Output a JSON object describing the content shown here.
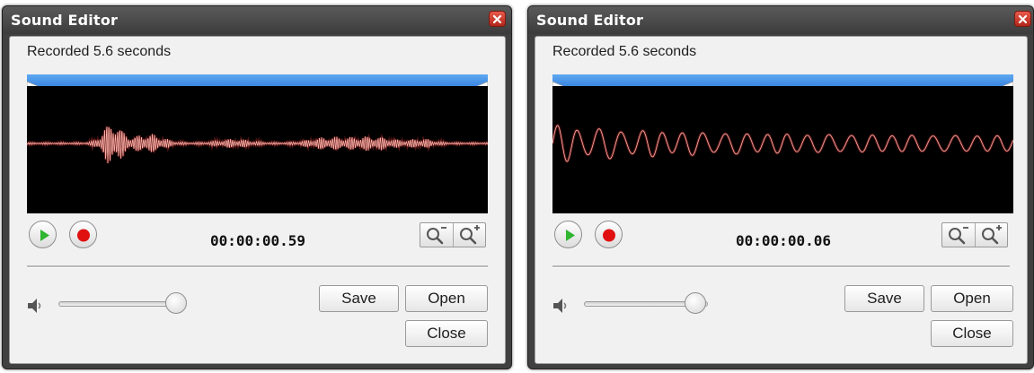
{
  "windows": [
    {
      "title": "Sound Editor",
      "status_text": "Recorded 5.6 seconds",
      "timecode": "00:00:00.59",
      "volume_level": 0.95,
      "buttons": {
        "save": "Save",
        "open": "Open",
        "close": "Close"
      }
    },
    {
      "title": "Sound Editor",
      "status_text": "Recorded 5.6 seconds",
      "timecode": "00:00:00.06",
      "volume_level": 0.9,
      "buttons": {
        "save": "Save",
        "open": "Open",
        "close": "Close"
      }
    }
  ],
  "icons": {
    "window_close": "close-x-icon",
    "play": "play-icon",
    "record": "record-icon",
    "zoom_out": "zoom-out-icon",
    "zoom_in": "zoom-in-icon",
    "volume": "speaker-icon"
  },
  "colors": {
    "selection_bar": "#4a97ea",
    "waveform": "#e83a3a",
    "waveform_bg": "#000000",
    "play_green": "#2fb52f",
    "record_red": "#e01010",
    "close_red": "#d0392a"
  }
}
